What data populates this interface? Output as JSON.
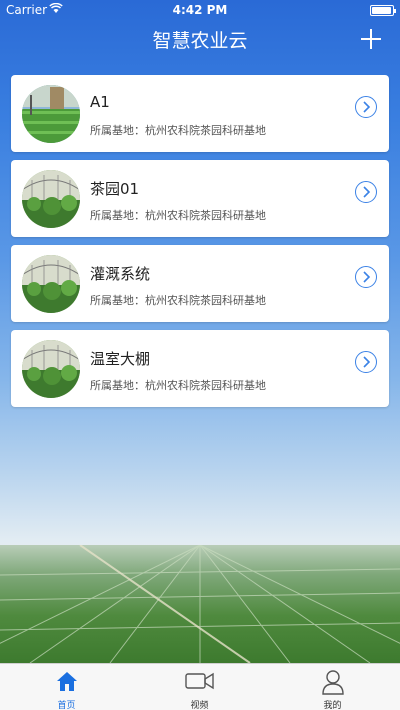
{
  "status_bar": {
    "carrier": "Carrier",
    "time": "4:42 PM"
  },
  "nav": {
    "title": "智慧农业云"
  },
  "list": [
    {
      "title": "A1",
      "subtitle": "所属基地：杭州农科院茶园科研基地"
    },
    {
      "title": "茶园01",
      "subtitle": "所属基地：杭州农科院茶园科研基地"
    },
    {
      "title": "灌溉系统",
      "subtitle": "所属基地：杭州农科院茶园科研基地"
    },
    {
      "title": "温室大棚",
      "subtitle": "所属基地：杭州农科院茶园科研基地"
    }
  ],
  "tabs": [
    {
      "label": "首页",
      "icon": "home-icon",
      "active": true
    },
    {
      "label": "视频",
      "icon": "video-camera-icon",
      "active": false
    },
    {
      "label": "我的",
      "icon": "person-icon",
      "active": false
    }
  ],
  "colors": {
    "accent": "#1a6fe0",
    "nav_bg": "#2a6ad6"
  }
}
